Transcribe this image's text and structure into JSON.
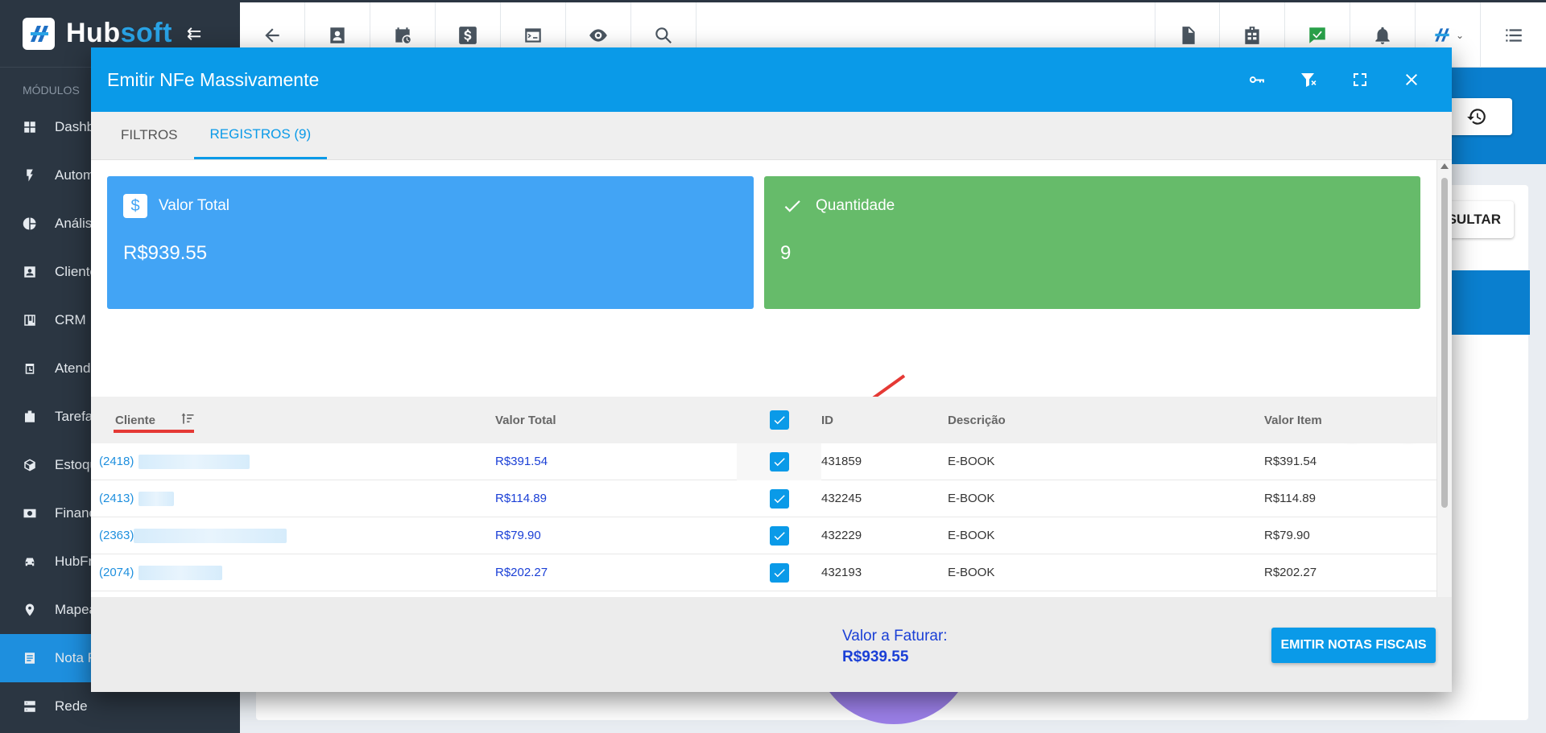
{
  "app": {
    "logo_hub": "Hub",
    "logo_soft": "soft"
  },
  "sidebar": {
    "section_label": "MÓDULOS",
    "items": [
      {
        "label": "Dashb",
        "icon": "dashboard-icon"
      },
      {
        "label": "Autom",
        "icon": "automation-icon"
      },
      {
        "label": "Anális",
        "icon": "analytics-icon"
      },
      {
        "label": "Cliente",
        "icon": "clients-icon"
      },
      {
        "label": "CRM",
        "icon": "crm-icon"
      },
      {
        "label": "Atendi",
        "icon": "service-icon"
      },
      {
        "label": "Tarefa",
        "icon": "tasks-icon"
      },
      {
        "label": "Estoqu",
        "icon": "inventory-icon"
      },
      {
        "label": "Financ",
        "icon": "finance-icon"
      },
      {
        "label": "HubFr",
        "icon": "car-icon"
      },
      {
        "label": "Mapea",
        "icon": "map-pin-icon"
      },
      {
        "label": "Nota F",
        "icon": "document-icon"
      },
      {
        "label": "Rede",
        "icon": "network-icon"
      }
    ]
  },
  "background": {
    "consultar_label": "NSULTAR"
  },
  "modal": {
    "title": "Emitir NFe Massivamente",
    "tabs": [
      {
        "label": "FILTROS"
      },
      {
        "label": "REGISTROS (9)"
      }
    ],
    "cards": {
      "total_label": "Valor Total",
      "total_icon_glyph": "$",
      "total_value": "R$939.55",
      "qty_label": "Quantidade",
      "qty_value": "9"
    },
    "table": {
      "headers": {
        "cliente": "Cliente",
        "valor_total": "Valor Total",
        "id": "ID",
        "descricao": "Descrição",
        "valor_item": "Valor Item"
      },
      "rows": [
        {
          "cliente": "(2418)",
          "valor": "R$391.54",
          "id": "431859",
          "descricao": "E-BOOK",
          "valor_item": "R$391.54"
        },
        {
          "cliente": "(2413)",
          "valor": "R$114.89",
          "id": "432245",
          "descricao": "E-BOOK",
          "valor_item": "R$114.89"
        },
        {
          "cliente": "(2363)",
          "valor": "R$79.90",
          "id": "432229",
          "descricao": "E-BOOK",
          "valor_item": "R$79.90"
        },
        {
          "cliente": "(2074)",
          "valor": "R$202.27",
          "id": "432193",
          "descricao": "E-BOOK",
          "valor_item": "R$202.27"
        }
      ]
    },
    "footer": {
      "label": "Valor a Faturar:",
      "value": "R$939.55",
      "button": "EMITIR NOTAS FISCAIS"
    }
  },
  "colors": {
    "primary": "#0a9ae8",
    "card_blue": "#42a4f5",
    "card_green": "#66bb6a",
    "sidebar_bg": "#2b3642",
    "pdf_red": "#f0443a",
    "excel_green": "#43a047"
  }
}
